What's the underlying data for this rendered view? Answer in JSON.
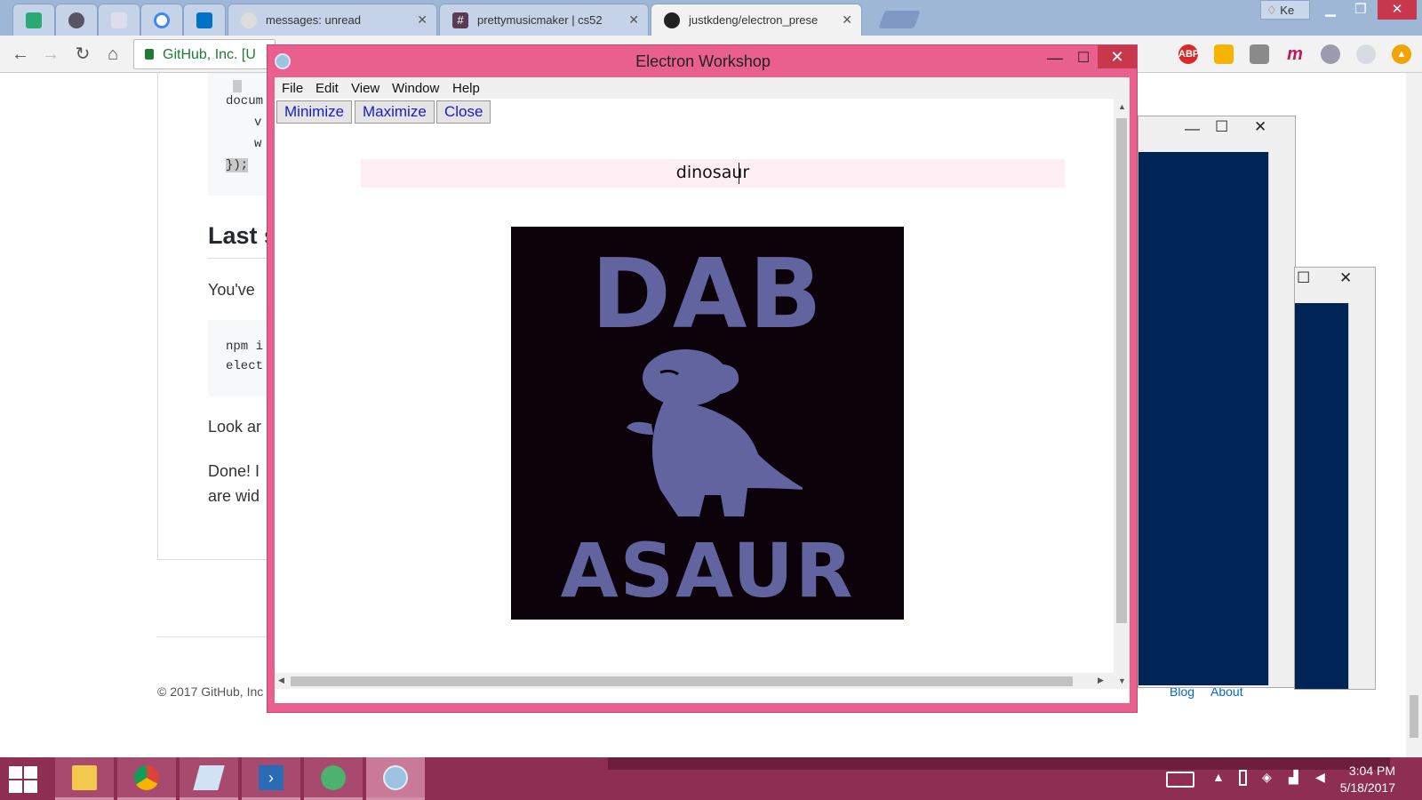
{
  "browser": {
    "tabs": [
      {
        "label": "messages: unread",
        "favicon": "reddit-icon"
      },
      {
        "label": "prettymusicmaker | cs52",
        "favicon": "slack-icon"
      },
      {
        "label": "justkdeng/electron_prese",
        "favicon": "github-icon",
        "active": true
      }
    ],
    "user_chip": "Ke",
    "address": "GitHub, Inc. [U",
    "extensions": [
      "ABP",
      "m"
    ]
  },
  "github_page": {
    "code_top": [
      "docum",
      "v",
      "w",
      "});"
    ],
    "heading": "Last s",
    "paragraph1": "You've",
    "code_cmd": [
      "npm i",
      "elect"
    ],
    "paragraph2": "Look ar",
    "paragraph3_line1": "Done! I",
    "paragraph3_line2": "are wid",
    "copyright": "© 2017 GitHub, Inc",
    "footer_links": [
      "Blog",
      "About"
    ]
  },
  "electron": {
    "title": "Electron Workshop",
    "menu": [
      "File",
      "Edit",
      "View",
      "Window",
      "Help"
    ],
    "buttons": {
      "minimize": "Minimize",
      "maximize": "Maximize",
      "close": "Close"
    },
    "search_value": "dinosaur",
    "gif_text_top": "DAB",
    "gif_text_bottom": "ASAUR"
  },
  "taskbar": {
    "apps": [
      "file-explorer-icon",
      "chrome-icon",
      "notepad-icon",
      "powershell-icon",
      "atom-icon",
      "electron-icon"
    ],
    "time": "3:04 PM",
    "date": "5/18/2017"
  },
  "colors": {
    "electron_frame": "#e9608f",
    "search_bg": "#fdeef4",
    "gif_bg": "#0c020a",
    "gif_ink": "#6264a0",
    "taskbar": "#8e2f52"
  }
}
